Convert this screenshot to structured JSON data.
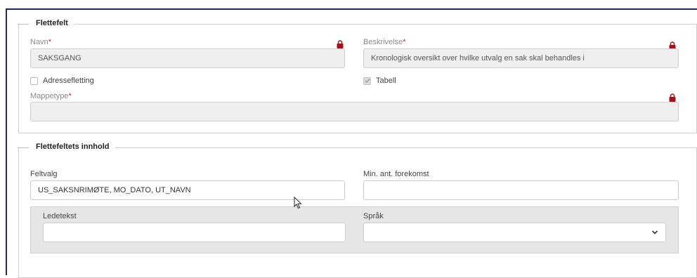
{
  "flettefelt": {
    "legend": "Flettefelt",
    "navn_label": "Navn",
    "navn_value": "SAKSGANG",
    "beskrivelse_label": "Beskrivelse",
    "beskrivelse_value": "Kronologisk oversikt over hvilke utvalg en sak skal behandles i",
    "adressefletting_label": "Adressefletting",
    "adressefletting_checked": false,
    "tabell_label": "Tabell",
    "tabell_checked": true,
    "mappetype_label": "Mappetype",
    "mappetype_value": "",
    "required_marker": "*"
  },
  "innhold": {
    "legend": "Flettefeltets innhold",
    "feltvalg_label": "Feltvalg",
    "feltvalg_value": "US_SAKSNRIMØTE, MO_DATO, UT_NAVN",
    "min_label": "Min. ant. forekomst",
    "min_value": "",
    "ledetekst_label": "Ledetekst",
    "ledetekst_value": "",
    "sprak_label": "Språk",
    "sprak_value": ""
  },
  "icons": {
    "lock": "lock-icon",
    "chevron": "chevron-down-icon",
    "check": "checkmark-icon",
    "cursor": "mouse-pointer-icon"
  },
  "colors": {
    "required": "#c0262d",
    "lock": "#a0141e",
    "frame_border": "#1e2a5e"
  }
}
